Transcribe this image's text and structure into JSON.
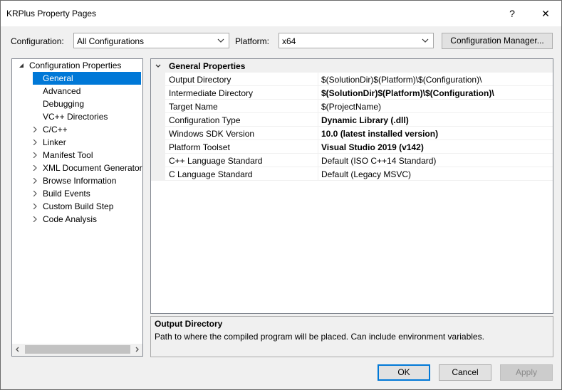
{
  "window": {
    "title": "KRPlus Property Pages",
    "help_label": "?",
    "close_label": "✕"
  },
  "toolbar": {
    "configuration_label": "Configuration:",
    "configuration_value": "All Configurations",
    "platform_label": "Platform:",
    "platform_value": "x64",
    "config_manager_label": "Configuration Manager..."
  },
  "tree": {
    "root_label": "Configuration Properties",
    "items": [
      {
        "label": "General",
        "expandable": false,
        "selected": true
      },
      {
        "label": "Advanced",
        "expandable": false,
        "selected": false
      },
      {
        "label": "Debugging",
        "expandable": false,
        "selected": false
      },
      {
        "label": "VC++ Directories",
        "expandable": false,
        "selected": false
      },
      {
        "label": "C/C++",
        "expandable": true,
        "selected": false
      },
      {
        "label": "Linker",
        "expandable": true,
        "selected": false
      },
      {
        "label": "Manifest Tool",
        "expandable": true,
        "selected": false
      },
      {
        "label": "XML Document Generator",
        "expandable": true,
        "selected": false
      },
      {
        "label": "Browse Information",
        "expandable": true,
        "selected": false
      },
      {
        "label": "Build Events",
        "expandable": true,
        "selected": false
      },
      {
        "label": "Custom Build Step",
        "expandable": true,
        "selected": false
      },
      {
        "label": "Code Analysis",
        "expandable": true,
        "selected": false
      }
    ]
  },
  "grid": {
    "section_title": "General Properties",
    "rows": [
      {
        "name": "Output Directory",
        "value": "$(SolutionDir)$(Platform)\\$(Configuration)\\",
        "bold": false
      },
      {
        "name": "Intermediate Directory",
        "value": "$(SolutionDir)$(Platform)\\$(Configuration)\\",
        "bold": true
      },
      {
        "name": "Target Name",
        "value": "$(ProjectName)",
        "bold": false
      },
      {
        "name": "Configuration Type",
        "value": "Dynamic Library (.dll)",
        "bold": true
      },
      {
        "name": "Windows SDK Version",
        "value": "10.0 (latest installed version)",
        "bold": true
      },
      {
        "name": "Platform Toolset",
        "value": "Visual Studio 2019 (v142)",
        "bold": true
      },
      {
        "name": "C++ Language Standard",
        "value": "Default (ISO C++14 Standard)",
        "bold": false
      },
      {
        "name": "C Language Standard",
        "value": "Default (Legacy MSVC)",
        "bold": false
      }
    ]
  },
  "description": {
    "title": "Output Directory",
    "text": "Path to where the compiled program will be placed. Can include environment variables."
  },
  "buttons": {
    "ok_label": "OK",
    "cancel_label": "Cancel",
    "apply_label": "Apply"
  }
}
